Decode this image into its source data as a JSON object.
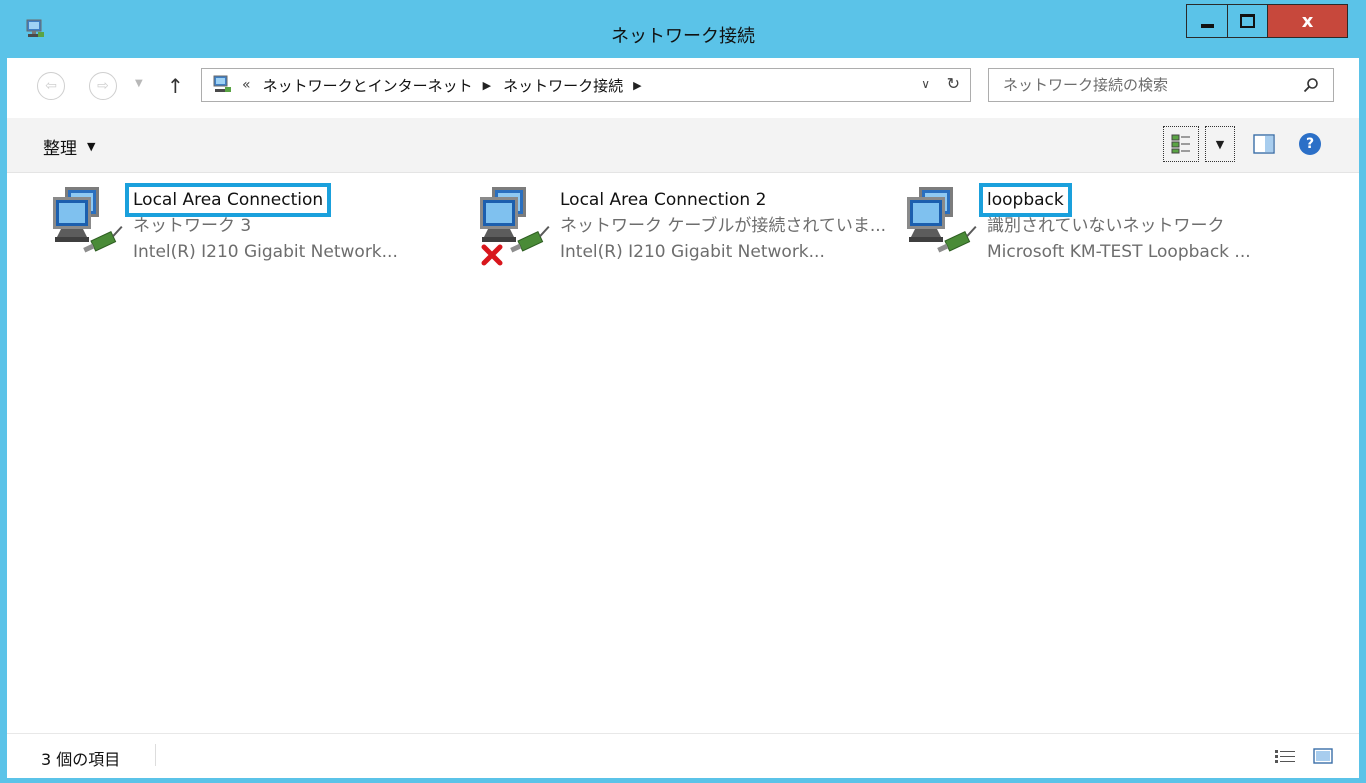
{
  "window": {
    "title": "ネットワーク接続",
    "close_label": "x"
  },
  "navigation": {
    "breadcrumb_prefix": "«",
    "breadcrumbs": [
      "ネットワークとインターネット",
      "ネットワーク接続"
    ],
    "search_placeholder": "ネットワーク接続の検索"
  },
  "toolbar": {
    "organize_label": "整理",
    "help_label": "?"
  },
  "items": [
    {
      "name": "Local Area Connection",
      "status": "ネットワーク 3",
      "adapter": "Intel(R) I210 Gigabit Network...",
      "selected": true,
      "disconnected": false
    },
    {
      "name": "Local Area Connection 2",
      "status": "ネットワーク ケーブルが接続されていま...",
      "adapter": "Intel(R) I210 Gigabit Network...",
      "selected": false,
      "disconnected": true
    },
    {
      "name": "loopback",
      "status": "識別されていないネットワーク",
      "adapter": "Microsoft KM-TEST Loopback ...",
      "selected": true,
      "disconnected": false
    }
  ],
  "statusbar": {
    "item_count": "3 個の項目"
  },
  "colors": {
    "frame": "#5bc3e8",
    "close_button": "#c7483c",
    "selection": "#1aa0dc",
    "disconnected_x": "#d8161c"
  }
}
